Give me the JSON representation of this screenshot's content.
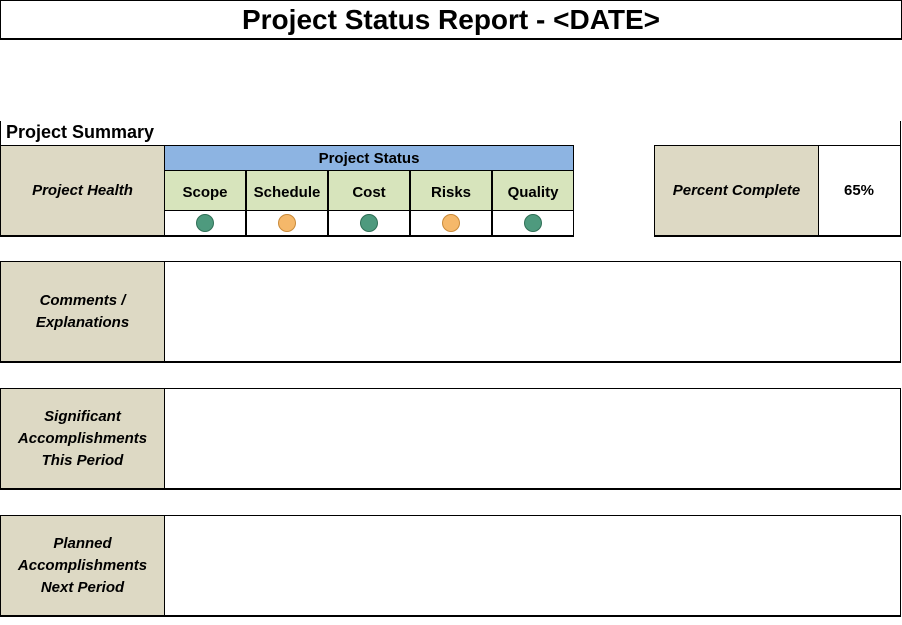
{
  "title": "Project Status Report - <DATE>",
  "section_title": "Project Summary",
  "project_health": {
    "label": "Project Health",
    "status_header": "Project Status",
    "columns": [
      {
        "label": "Scope",
        "status": "green",
        "color": "#4e9a7e"
      },
      {
        "label": "Schedule",
        "status": "amber",
        "color": "#f5b86a"
      },
      {
        "label": "Cost",
        "status": "green",
        "color": "#4e9a7e"
      },
      {
        "label": "Risks",
        "status": "amber",
        "color": "#f5b86a"
      },
      {
        "label": "Quality",
        "status": "green",
        "color": "#4e9a7e"
      }
    ]
  },
  "percent_complete": {
    "label": "Percent Complete",
    "value": "65%"
  },
  "rows": {
    "comments": {
      "line1": "Comments /",
      "line2": "Explanations",
      "content": ""
    },
    "accomplishments": {
      "line1": "Significant",
      "line2": "Accomplishments",
      "line3": "This Period",
      "content": ""
    },
    "planned": {
      "line1": "Planned",
      "line2": "Accomplishments",
      "line3": "Next Period",
      "content": ""
    }
  },
  "colors": {
    "label_bg": "#ddd9c4",
    "status_header_bg": "#8db4e2",
    "status_col_bg": "#d7e4bc"
  }
}
